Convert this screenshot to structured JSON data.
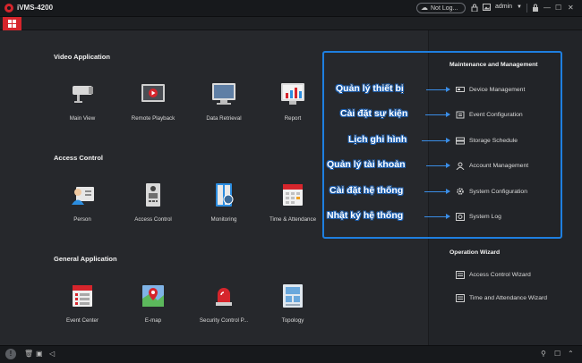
{
  "window": {
    "title": "iVMS-4200",
    "cloud_status": "Not Log...",
    "user": "admin"
  },
  "sections": {
    "video": {
      "title": "Video Application",
      "items": [
        {
          "label": "Main View",
          "icon": "camera-icon"
        },
        {
          "label": "Remote Playback",
          "icon": "playback-icon"
        },
        {
          "label": "Data Retrieval",
          "icon": "monitor-search-icon"
        },
        {
          "label": "Report",
          "icon": "report-chart-icon"
        }
      ]
    },
    "access": {
      "title": "Access Control",
      "items": [
        {
          "label": "Person",
          "icon": "person-card-icon"
        },
        {
          "label": "Access Control",
          "icon": "door-station-icon"
        },
        {
          "label": "Monitoring",
          "icon": "monitoring-icon"
        },
        {
          "label": "Time & Attendance",
          "icon": "calendar-icon"
        }
      ]
    },
    "general": {
      "title": "General Application",
      "items": [
        {
          "label": "Event Center",
          "icon": "event-center-icon"
        },
        {
          "label": "E-map",
          "icon": "map-pin-icon"
        },
        {
          "label": "Security Control P...",
          "icon": "alarm-siren-icon"
        },
        {
          "label": "Topology",
          "icon": "topology-icon"
        }
      ]
    }
  },
  "maintenance": {
    "title": "Maintenance and Management",
    "items": [
      {
        "label": "Device Management",
        "icon": "device-icon"
      },
      {
        "label": "Event Configuration",
        "icon": "event-config-icon"
      },
      {
        "label": "Storage Schedule",
        "icon": "storage-icon"
      },
      {
        "label": "Account Management",
        "icon": "account-icon"
      },
      {
        "label": "System Configuration",
        "icon": "gear-icon"
      },
      {
        "label": "System Log",
        "icon": "log-icon"
      }
    ]
  },
  "wizard": {
    "title": "Operation Wizard",
    "items": [
      {
        "label": "Access Control Wizard",
        "icon": "wizard-icon"
      },
      {
        "label": "Time and Attendance Wizard",
        "icon": "wizard-icon"
      }
    ]
  },
  "annotations": [
    "Quản lý thiết bị",
    "Cài đặt sự kiện",
    "Lịch ghi hình",
    "Quản lý tài khoản",
    "Cài đặt hệ thống",
    "Nhật ký hệ thống"
  ],
  "colors": {
    "accent": "#d6252c",
    "highlight": "#1e7fe0",
    "background": "#26282c"
  }
}
